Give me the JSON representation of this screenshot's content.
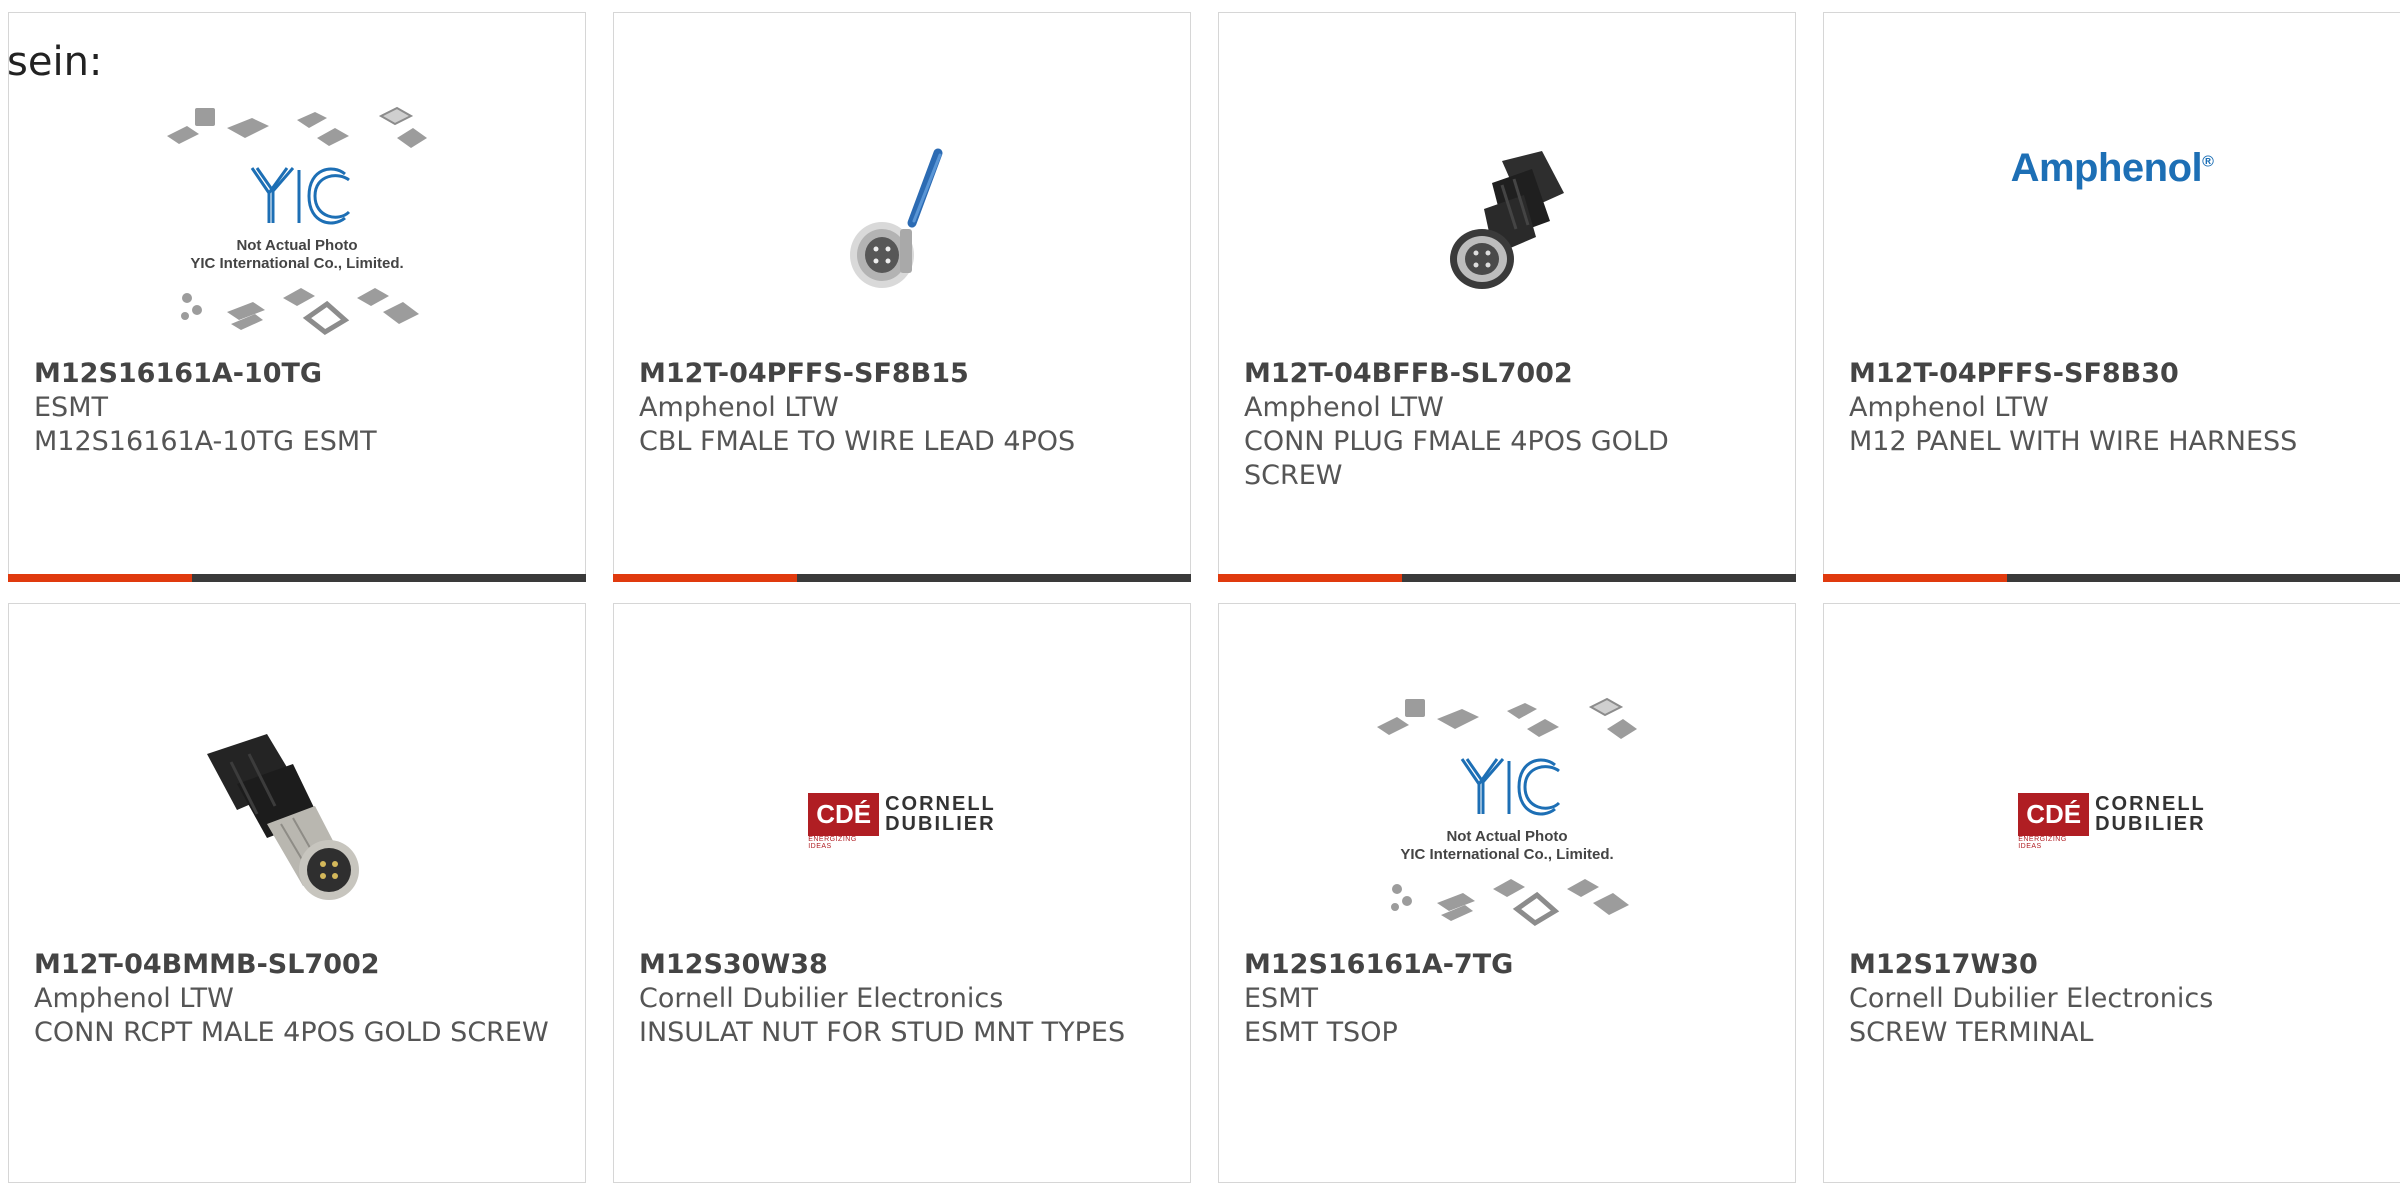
{
  "page": {
    "label": "sein:"
  },
  "colors": {
    "accent": "#e03a0e",
    "bar": "#3a3a3a",
    "border": "#d6d6d6",
    "text": "#555555",
    "amphenol_blue": "#1d6fb5",
    "cde_red": "#b01e23"
  },
  "image_text": {
    "yic_line1": "Not Actual Photo",
    "yic_line2": "YIC International Co., Limited.",
    "amphenol": "Amphenol",
    "amphenol_mark": "®",
    "cde_box": "CDÉ",
    "cde_tag": "ENERGIZING IDEAS",
    "cde_line1": "CORNELL",
    "cde_line2": "DUBILIER"
  },
  "products": [
    {
      "part_number": "M12S16161A-10TG",
      "manufacturer": "ESMT",
      "description": "M12S16161A-10TG ESMT",
      "image_type": "yic-placeholder"
    },
    {
      "part_number": "M12T-04PFFS-SF8B15",
      "manufacturer": "Amphenol LTW",
      "description": "CBL FMALE TO WIRE LEAD 4POS",
      "image_type": "panel-connector-photo"
    },
    {
      "part_number": "M12T-04BFFB-SL7002",
      "manufacturer": "Amphenol LTW",
      "description": "CONN PLUG FMALE 4POS GOLD SCREW",
      "image_type": "female-plug-photo"
    },
    {
      "part_number": "M12T-04PFFS-SF8B30",
      "manufacturer": "Amphenol LTW",
      "description": "M12 PANEL WITH WIRE HARNESS",
      "image_type": "amphenol-logo"
    },
    {
      "part_number": "M12T-04BMMB-SL7002",
      "manufacturer": "Amphenol LTW",
      "description": "CONN RCPT MALE 4POS GOLD SCREW",
      "image_type": "male-plug-photo"
    },
    {
      "part_number": "M12S30W38",
      "manufacturer": "Cornell Dubilier Electronics",
      "description": "INSULAT NUT FOR STUD MNT TYPES",
      "image_type": "cde-logo"
    },
    {
      "part_number": "M12S16161A-7TG",
      "manufacturer": "ESMT",
      "description": "ESMT TSOP",
      "image_type": "yic-placeholder"
    },
    {
      "part_number": "M12S17W30",
      "manufacturer": "Cornell Dubilier Electronics",
      "description": "SCREW TERMINAL",
      "image_type": "cde-logo"
    }
  ]
}
